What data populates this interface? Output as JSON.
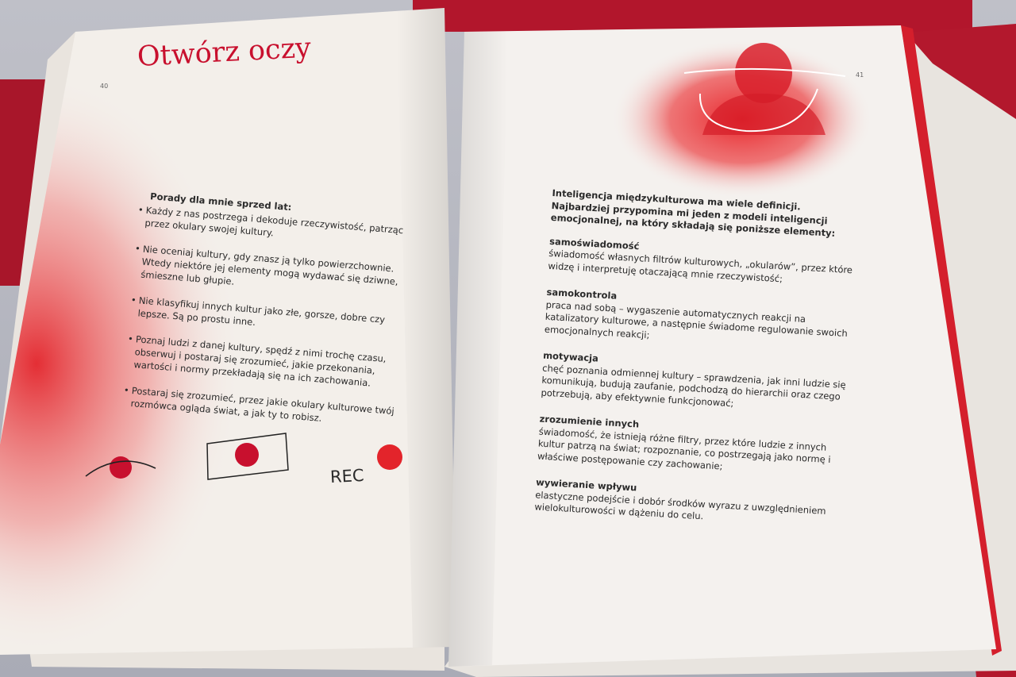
{
  "left_page": {
    "title": "Otwórz oczy",
    "page_number": "40",
    "tips_heading": "Porady dla mnie sprzed lat:",
    "tips": [
      "Każdy z nas postrzega i dekoduje rzeczywistość, patrząc przez okulary swojej kultury.",
      "Nie oceniaj kultury, gdy znasz ją tylko powierzchownie. Wtedy niektóre jej elementy mogą wydawać się dziwne, śmieszne lub głupie.",
      "Nie klasyfikuj innych kultur jako złe, gorsze, dobre czy lepsze. Są po prostu inne.",
      "Poznaj ludzi z danej kultury, spędź z nimi trochę czasu, obserwuj i postaraj się zrozumieć, jakie przekonania, wartości i normy przekładają się na ich zachowania.",
      "Postaraj się zrozumieć, przez jakie okulary kulturowe twój rozmówca ogląda świat, a jak ty to robisz."
    ],
    "rec_label": "REC",
    "accent_color": "#c8102e"
  },
  "right_page": {
    "page_number": "41",
    "intro": "Inteligencja międzykulturowa ma wiele definicji. Najbardziej przypomina mi jeden z modeli inteligencji emocjonalnej, na który składają się poniższe elementy:",
    "elements": [
      {
        "term": "samoświadomość",
        "definition": "świadomość własnych filtrów kulturowych, „okularów”, przez które widzę i interpretuję otaczającą mnie rzeczywistość;"
      },
      {
        "term": "samokontrola",
        "definition": "praca nad sobą – wygaszenie automatycznych reakcji na katalizatory kulturowe, a następnie świadome regulowanie swoich emocjonalnych reakcji;"
      },
      {
        "term": "motywacja",
        "definition": "chęć poznania odmiennej kultury – sprawdzenia, jak inni ludzie się komunikują, budują zaufanie, podchodzą do hierarchii oraz czego potrzebują, aby efektywnie funkcjonować;"
      },
      {
        "term": "zrozumienie innych",
        "definition": "świadomość, że istnieją różne filtry, przez które ludzie z innych kultur patrzą na świat; rozpoznanie, co postrzegają jako normę i właściwe postępowanie czy zachowanie;"
      },
      {
        "term": "wywieranie wpływu",
        "definition": "elastyczne podejście i dobór środków wyrazu z uwzględnieniem wielokulturowości w dążeniu do celu."
      }
    ]
  }
}
